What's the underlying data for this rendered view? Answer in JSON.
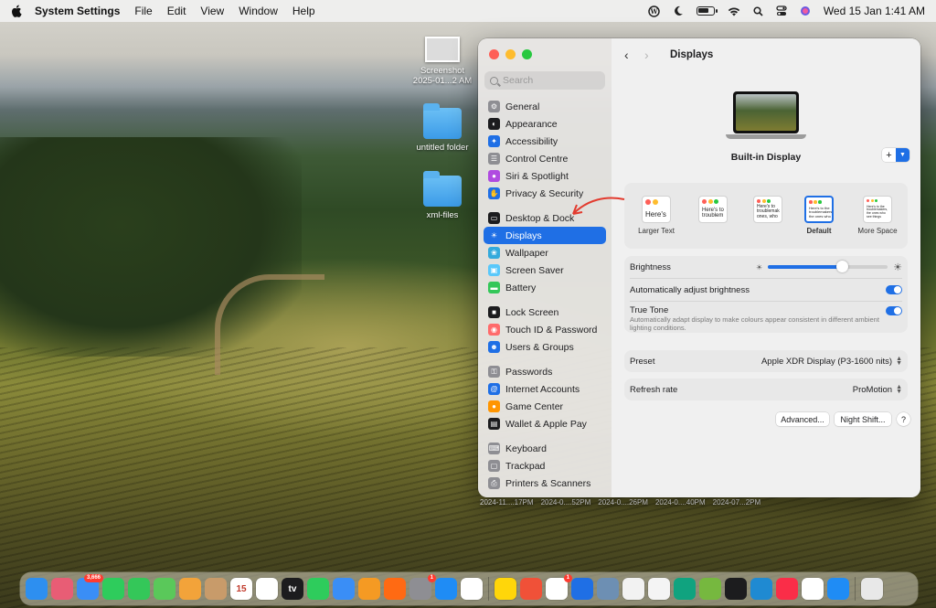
{
  "menubar": {
    "app_name": "System Settings",
    "items": [
      "File",
      "Edit",
      "View",
      "Window",
      "Help"
    ],
    "clock": "Wed 15 Jan  1:41 AM"
  },
  "desktop": {
    "items": [
      {
        "label": "Screenshot 2025-01...2 AM",
        "kind": "screenshot"
      },
      {
        "label": "untitled folder",
        "kind": "folder"
      },
      {
        "label": "xml-files",
        "kind": "folder"
      }
    ],
    "bottom_labels": [
      "2024-11....17PM",
      "2024-0....52PM",
      "2024-0....26PM",
      "2024-0....40PM",
      "2024-07...2PM"
    ]
  },
  "sidebar": {
    "search_placeholder": "Search",
    "groups": [
      [
        {
          "label": "General",
          "icon": "gear-icon",
          "color": "#8e8e93"
        },
        {
          "label": "Appearance",
          "icon": "appearance-icon",
          "color": "#1c1c1e"
        },
        {
          "label": "Accessibility",
          "icon": "accessibility-icon",
          "color": "#1f6fe5"
        },
        {
          "label": "Control Centre",
          "icon": "control-centre-icon",
          "color": "#8e8e93"
        },
        {
          "label": "Siri & Spotlight",
          "icon": "siri-icon",
          "color": "#b04be0"
        },
        {
          "label": "Privacy & Security",
          "icon": "hand-icon",
          "color": "#1f6fe5"
        }
      ],
      [
        {
          "label": "Desktop & Dock",
          "icon": "dock-icon",
          "color": "#1c1c1e"
        },
        {
          "label": "Displays",
          "icon": "sun-icon",
          "color": "#1f6fe5",
          "selected": true
        },
        {
          "label": "Wallpaper",
          "icon": "wallpaper-icon",
          "color": "#34aadc"
        },
        {
          "label": "Screen Saver",
          "icon": "screensaver-icon",
          "color": "#5ac8fa"
        },
        {
          "label": "Battery",
          "icon": "battery-icon",
          "color": "#34c759"
        }
      ],
      [
        {
          "label": "Lock Screen",
          "icon": "lock-icon",
          "color": "#1c1c1e"
        },
        {
          "label": "Touch ID & Password",
          "icon": "fingerprint-icon",
          "color": "#ff6b6b"
        },
        {
          "label": "Users & Groups",
          "icon": "users-icon",
          "color": "#1f6fe5"
        }
      ],
      [
        {
          "label": "Passwords",
          "icon": "key-icon",
          "color": "#8e8e93"
        },
        {
          "label": "Internet Accounts",
          "icon": "at-icon",
          "color": "#1f6fe5"
        },
        {
          "label": "Game Center",
          "icon": "game-center-icon",
          "color": "#ff9500"
        },
        {
          "label": "Wallet & Apple Pay",
          "icon": "wallet-icon",
          "color": "#1c1c1e"
        }
      ],
      [
        {
          "label": "Keyboard",
          "icon": "keyboard-icon",
          "color": "#8e8e93"
        },
        {
          "label": "Trackpad",
          "icon": "trackpad-icon",
          "color": "#8e8e93"
        },
        {
          "label": "Printers & Scanners",
          "icon": "printer-icon",
          "color": "#8e8e93"
        }
      ]
    ]
  },
  "main": {
    "title": "Displays",
    "display_name": "Built-in Display",
    "add_label": "+",
    "resolutions": [
      {
        "label": "Larger Text",
        "sample": "Here's",
        "selected": false
      },
      {
        "label": "",
        "sample": "Here's to troublem",
        "selected": false
      },
      {
        "label": "",
        "sample": "Here's to troublemak ones, who",
        "selected": false
      },
      {
        "label": "Default",
        "sample": "Here's to the troublemakers, the ones who",
        "selected": true
      },
      {
        "label": "More Space",
        "sample": "Here's to the troublemakers, the ones who see things",
        "selected": false
      }
    ],
    "brightness": {
      "label": "Brightness",
      "level": 0.62
    },
    "auto_brightness": {
      "label": "Automatically adjust brightness",
      "on": true
    },
    "true_tone": {
      "label": "True Tone",
      "description": "Automatically adapt display to make colours appear consistent in different ambient lighting conditions.",
      "on": true
    },
    "preset": {
      "label": "Preset",
      "value": "Apple XDR Display (P3-1600 nits)"
    },
    "refresh_rate": {
      "label": "Refresh rate",
      "value": "ProMotion"
    },
    "buttons": {
      "advanced": "Advanced...",
      "night_shift": "Night Shift...",
      "help": "?"
    }
  },
  "dock": {
    "apps": [
      {
        "name": "finder-icon",
        "color": "#2d8ff0"
      },
      {
        "name": "launchpad-icon",
        "color": "#e85d75"
      },
      {
        "name": "mail-icon",
        "color": "#3a8ef6",
        "badge": "3,666"
      },
      {
        "name": "facetime-icon",
        "color": "#2ecc5c"
      },
      {
        "name": "messages-icon",
        "color": "#34c759"
      },
      {
        "name": "maps-icon",
        "color": "#5ac85a"
      },
      {
        "name": "photos-icon",
        "color": "#f2a33a"
      },
      {
        "name": "contacts-icon",
        "color": "#c89b6a"
      },
      {
        "name": "calendar-icon",
        "color": "#ffffff",
        "text": "15"
      },
      {
        "name": "reminders-icon",
        "color": "#ffffff"
      },
      {
        "name": "tv-icon",
        "color": "#1c1c1e",
        "text": "tv"
      },
      {
        "name": "numbers-icon",
        "color": "#2ecc5c"
      },
      {
        "name": "keynote-icon",
        "color": "#3a8ef6"
      },
      {
        "name": "pages-icon",
        "color": "#f59a23"
      },
      {
        "name": "firefox-icon",
        "color": "#ff6a13"
      },
      {
        "name": "system-settings-icon",
        "color": "#8e8e93",
        "badge": "1"
      },
      {
        "name": "app-store-icon",
        "color": "#1f8cf5"
      },
      {
        "name": "freeform-icon",
        "color": "#ffffff"
      },
      {
        "name": "notes-icon",
        "color": "#ffd60a"
      },
      {
        "name": "swift-icon",
        "color": "#f05138"
      },
      {
        "name": "slack-icon",
        "color": "#ffffff",
        "badge": "1"
      },
      {
        "name": "maps-pin-icon",
        "color": "#1f6fe5"
      },
      {
        "name": "preview-icon",
        "color": "#6d8fb3"
      },
      {
        "name": "textedit-icon",
        "color": "#f2f2f2"
      },
      {
        "name": "mongodb-icon",
        "color": "#f4f4f4"
      },
      {
        "name": "chatgpt-icon",
        "color": "#10a37f"
      },
      {
        "name": "utorrent-icon",
        "color": "#76b83f"
      },
      {
        "name": "terminal-icon",
        "color": "#1c1c1e"
      },
      {
        "name": "vscode-icon",
        "color": "#1f8ad2"
      },
      {
        "name": "music-icon",
        "color": "#fa2d48"
      },
      {
        "name": "chrome-icon",
        "color": "#ffffff"
      },
      {
        "name": "safari-icon",
        "color": "#1f8cf5"
      },
      {
        "name": "trash-icon",
        "color": "#e8e8e8"
      }
    ]
  }
}
